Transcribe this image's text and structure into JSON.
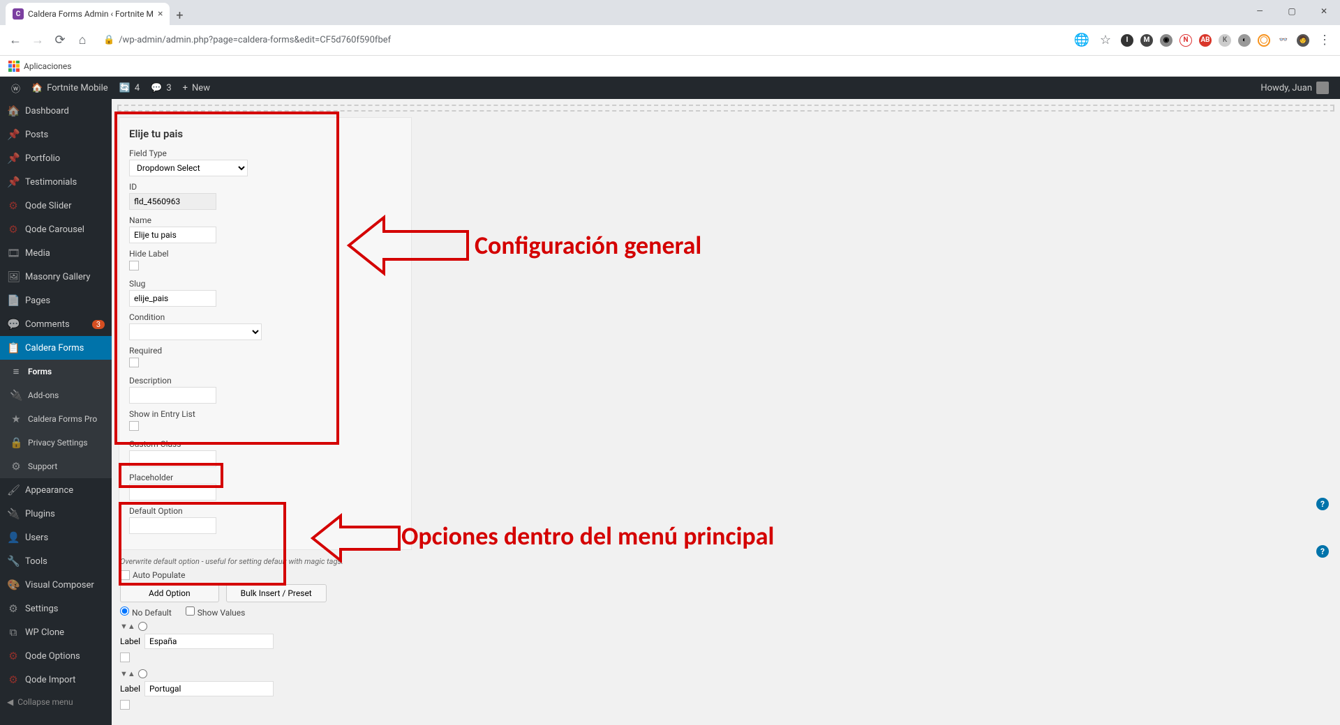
{
  "browser": {
    "tab_title": "Caldera Forms Admin ‹ Fortnite M",
    "url": "/wp-admin/admin.php?page=caldera-forms&edit=CF5d760f590fbef",
    "bookmarks_label": "Aplicaciones"
  },
  "win": {
    "min": "—",
    "max": "▢",
    "close": "✕"
  },
  "adminbar": {
    "site": "Fortnite Mobile",
    "updates": "4",
    "comments": "3",
    "new": "New",
    "howdy": "Howdy, Juan"
  },
  "sidebar": {
    "items": [
      {
        "icon": "🏠",
        "label": "Dashboard"
      },
      {
        "icon": "📌",
        "label": "Posts"
      },
      {
        "icon": "📌",
        "label": "Portfolio"
      },
      {
        "icon": "📌",
        "label": "Testimonials"
      },
      {
        "icon": "⚙",
        "label": "Qode Slider",
        "red": true
      },
      {
        "icon": "⚙",
        "label": "Qode Carousel",
        "red": true
      },
      {
        "icon": "🎞",
        "label": "Media"
      },
      {
        "icon": "🖼",
        "label": "Masonry Gallery"
      },
      {
        "icon": "📄",
        "label": "Pages"
      },
      {
        "icon": "💬",
        "label": "Comments",
        "badge": "3"
      },
      {
        "icon": "📋",
        "label": "Caldera Forms",
        "current": true
      }
    ],
    "submenu": [
      {
        "icon": "≡",
        "label": "Forms",
        "sub_current": true
      },
      {
        "icon": "🔌",
        "label": "Add-ons"
      },
      {
        "icon": "★",
        "label": "Caldera Forms Pro"
      },
      {
        "icon": "🔒",
        "label": "Privacy Settings"
      },
      {
        "icon": "⚙",
        "label": "Support"
      }
    ],
    "items2": [
      {
        "icon": "🖌",
        "label": "Appearance"
      },
      {
        "icon": "🔌",
        "label": "Plugins"
      },
      {
        "icon": "👤",
        "label": "Users"
      },
      {
        "icon": "🔧",
        "label": "Tools"
      },
      {
        "icon": "🎨",
        "label": "Visual Composer"
      },
      {
        "icon": "⚙",
        "label": "Settings"
      },
      {
        "icon": "⧉",
        "label": "WP Clone"
      },
      {
        "icon": "⚙",
        "label": "Qode Options",
        "red": true
      },
      {
        "icon": "⚙",
        "label": "Qode Import",
        "red": true
      }
    ],
    "collapse": "Collapse menu"
  },
  "panel": {
    "title": "Elije tu pais",
    "field_type_label": "Field Type",
    "field_type_value": "Dropdown Select",
    "id_label": "ID",
    "id_value": "fld_4560963",
    "name_label": "Name",
    "name_value": "Elije tu pais",
    "hide_label": "Hide Label",
    "slug_label": "Slug",
    "slug_value": "elije_pais",
    "condition_label": "Condition",
    "required_label": "Required",
    "description_label": "Description",
    "show_entry_label": "Show in Entry List",
    "custom_class_label": "Custom Class",
    "placeholder_label": "Placeholder",
    "default_option_label": "Default Option",
    "hint": "Overwrite default option - useful for setting default with magic tags.",
    "auto_populate": "Auto Populate",
    "add_option_btn": "Add Option",
    "bulk_btn": "Bulk Insert / Preset",
    "no_default": "No Default",
    "show_values": "Show Values",
    "opt_label": "Label",
    "opt1": "España",
    "opt2": "Portugal"
  },
  "annotations": {
    "text1": "Configuración general",
    "text2": "Opciones dentro del menú principal"
  }
}
